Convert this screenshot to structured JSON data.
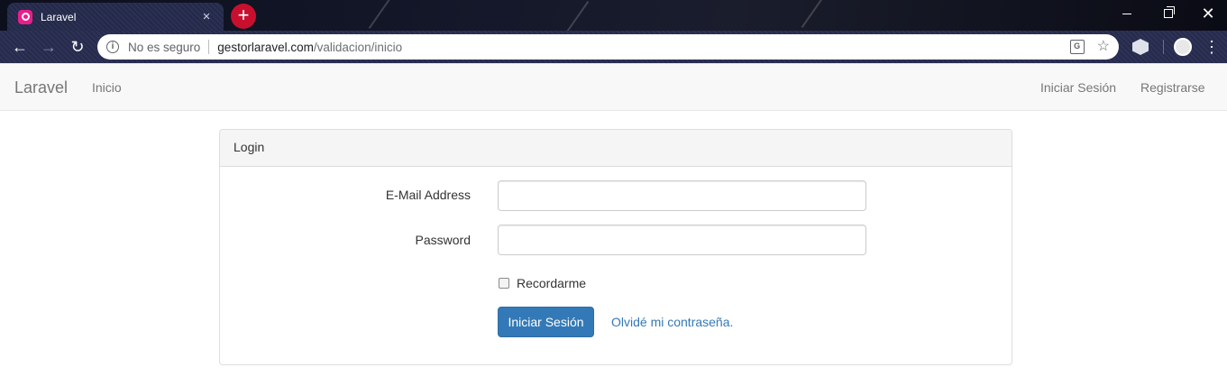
{
  "browser": {
    "tab_title": "Laravel",
    "tab_close": "×",
    "new_tab": "+",
    "security_label": "No es seguro",
    "url_host": "gestorlaravel.com",
    "url_path": "/validacion/inicio",
    "icons": [
      "back-icon",
      "forward-icon",
      "reload-icon",
      "info-icon",
      "translate-icon",
      "star-icon",
      "extension-icon",
      "profile-icon",
      "menu-icon"
    ]
  },
  "navbar": {
    "brand": "Laravel",
    "home": "Inicio",
    "login": "Iniciar Sesión",
    "register": "Registrarse"
  },
  "login_panel": {
    "heading": "Login",
    "email_label": "E-Mail Address",
    "email_value": "",
    "password_label": "Password",
    "password_value": "",
    "remember_label": "Recordarme",
    "remember_checked": false,
    "submit_label": "Iniciar Sesión",
    "forgot_link": "Olvidé mi contraseña."
  },
  "colors": {
    "primary": "#3379b7",
    "navbar_bg": "#f8f8f8",
    "panel_heading_bg": "#f5f5f5",
    "favicon": "#e91e8c",
    "new_tab": "#c8102e"
  }
}
